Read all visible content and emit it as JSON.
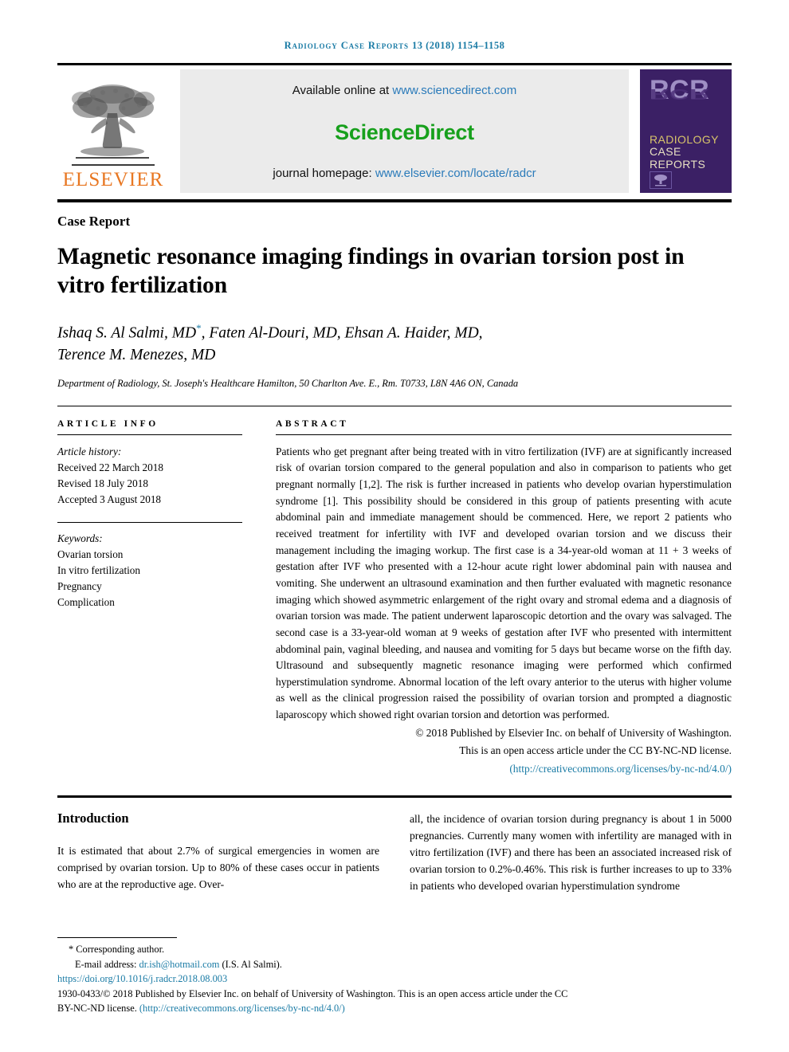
{
  "running_head": {
    "journal": "Radiology Case Reports",
    "volume_year_pages": "13 (2018) 1154–1158"
  },
  "masthead": {
    "publisher_name": "ELSEVIER",
    "available_prefix": "Available online at ",
    "sciencedirect_url": "www.sciencedirect.com",
    "sciencedirect_logo": "ScienceDirect",
    "homepage_prefix": "journal homepage: ",
    "homepage_url": "www.elsevier.com/locate/radcr",
    "cover": {
      "acronym": "RCR",
      "line1": "RADIOLOGY",
      "line2": "CASE",
      "line3": "REPORTS"
    }
  },
  "article": {
    "kicker": "Case Report",
    "title": "Magnetic resonance imaging findings in ovarian torsion post in vitro fertilization",
    "authors": "Ishaq S. Al Salmi, MD",
    "authors_rest": ", Faten Al-Douri, MD, Ehsan A. Haider, MD,",
    "authors_line2": "Terence M. Menezes, MD",
    "corresponding_marker": "*",
    "affiliation": "Department of Radiology, St. Joseph's Healthcare Hamilton, 50 Charlton Ave. E., Rm. T0733, L8N 4A6 ON, Canada"
  },
  "article_info": {
    "label": "ARTICLE INFO",
    "history_label": "Article history:",
    "received": "Received 22 March 2018",
    "revised": "Revised 18 July 2018",
    "accepted": "Accepted 3 August 2018",
    "keywords_label": "Keywords:",
    "keywords": [
      "Ovarian torsion",
      "In vitro fertilization",
      "Pregnancy",
      "Complication"
    ]
  },
  "abstract": {
    "label": "ABSTRACT",
    "text": "Patients who get pregnant after being treated with in vitro fertilization (IVF) are at significantly increased risk of ovarian torsion compared to the general population and also in comparison to patients who get pregnant normally [1,2]. The risk is further increased in patients who develop ovarian hyperstimulation syndrome [1]. This possibility should be considered in this group of patients presenting with acute abdominal pain and immediate management should be commenced. Here, we report 2 patients who received treatment for infertility with IVF and developed ovarian torsion and we discuss their management including the imaging workup. The first case is a 34-year-old woman at 11 + 3 weeks of gestation after IVF who presented with a 12-hour acute right lower abdominal pain with nausea and vomiting. She underwent an ultrasound examination and then further evaluated with magnetic resonance imaging which showed asymmetric enlargement of the right ovary and stromal edema and a diagnosis of ovarian torsion was made. The patient underwent laparoscopic detortion and the ovary was salvaged. The second case is a 33-year-old woman at 9 weeks of gestation after IVF who presented with intermittent abdominal pain, vaginal bleeding, and nausea and vomiting for 5 days but became worse on the fifth day. Ultrasound and subsequently magnetic resonance imaging were performed which confirmed hyperstimulation syndrome. Abnormal location of the left ovary anterior to the uterus with higher volume as well as the clinical progression raised the possibility of ovarian torsion and prompted a diagnostic laparoscopy which showed right ovarian torsion and detortion was performed.",
    "copyright_line1": "© 2018 Published by Elsevier Inc. on behalf of University of Washington.",
    "copyright_line2": "This is an open access article under the CC BY-NC-ND license.",
    "license_url": "(http://creativecommons.org/licenses/by-nc-nd/4.0/)"
  },
  "body": {
    "intro_heading": "Introduction",
    "intro_col1": "It is estimated that about 2.7% of surgical emergencies in women are comprised by ovarian torsion. Up to 80% of these cases occur in patients who are at the reproductive age. Over-",
    "intro_col2": "all, the incidence of ovarian torsion during pregnancy is about 1 in 5000 pregnancies. Currently many women with infertility are managed with in vitro fertilization (IVF) and there has been an associated increased risk of ovarian torsion to 0.2%-0.46%. This risk is further increases to up to 33% in patients who developed ovarian hyperstimulation syndrome"
  },
  "footnote": {
    "corresponding": "* Corresponding author.",
    "email_label": "E-mail address: ",
    "email": "dr.ish@hotmail.com",
    "email_suffix": " (I.S. Al Salmi).",
    "doi": "https://doi.org/10.1016/j.radcr.2018.08.003",
    "issn_line": "1930-0433/© 2018 Published by Elsevier Inc. on behalf of University of Washington. This is an open access article under the CC",
    "license_prefix": "BY-NC-ND license. ",
    "license_url": "(http://creativecommons.org/licenses/by-nc-nd/4.0/)"
  },
  "colors": {
    "journal_teal": "#1a7ba5",
    "link_blue": "#2b7bba",
    "sciencedirect_green": "#17A01C",
    "elsevier_orange": "#E87722",
    "cover_purple": "#3b2065"
  }
}
